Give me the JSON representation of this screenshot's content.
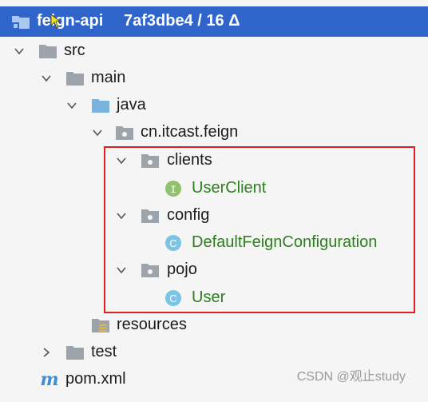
{
  "header": {
    "module": "feign-api",
    "commit": "7af3dbe4 / 16 Δ"
  },
  "tree": {
    "src": "src",
    "main": "main",
    "java": "java",
    "package": "cn.itcast.feign",
    "clients": "clients",
    "user_client": "UserClient",
    "config": "config",
    "default_config": "DefaultFeignConfiguration",
    "pojo": "pojo",
    "user": "User",
    "resources": "resources",
    "test": "test",
    "pom": "pom.xml"
  },
  "icons": {
    "interface_letter": "I",
    "class_letter": "C",
    "maven_letter": "m"
  },
  "watermark": "CSDN @观止study",
  "colors": {
    "selection": "#2f65ca",
    "green_text": "#2e7d1f",
    "highlight_border": "#e02020",
    "folder_gray": "#9da3ab",
    "folder_blue": "#7ab3dd",
    "interface_green": "#8fc26a",
    "class_blue": "#7cc4e6"
  }
}
